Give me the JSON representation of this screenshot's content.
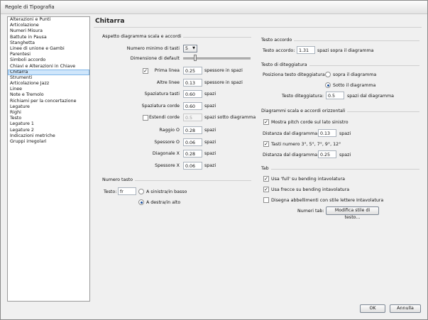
{
  "window": {
    "title": "Regole di Tipografia"
  },
  "sidebar": {
    "items": [
      "Alterazioni e Punti",
      "Articolazione",
      "Numeri Misura",
      "Battute in Pausa",
      "Stanghetta",
      "Linee di unione e Gambi",
      "Parentesi",
      "Simboli accordo",
      "Chiavi e Alterazioni in Chiave",
      "Chitarra",
      "Strumenti",
      "Articolazione Jazz",
      "Linee",
      "Note e Tremolo",
      "Richiami per la concertazione",
      "Legature",
      "Righi",
      "Testo",
      "Legature 1",
      "Legature 2",
      "Indicazioni metriche",
      "Gruppi irregolari"
    ],
    "selected": "Chitarra"
  },
  "page_title": "Chitarra",
  "scale": {
    "title": "Aspetto diagramma scala e accordi",
    "min_frets_label": "Numero minimo di tasti",
    "min_frets_value": "5",
    "default_size_label": "Dimensione di default",
    "first_line_label": "Prima linea",
    "first_line_value": "0.25",
    "first_line_checked": true,
    "first_line_unit": "spessore in spazi",
    "other_lines_label": "Altre linee",
    "other_lines_value": "0.13",
    "other_lines_unit": "spessore in spazi",
    "fret_spacing_label": "Spaziatura tasti",
    "fret_spacing_value": "0.60",
    "unit_spazi": "spazi",
    "string_spacing_label": "Spaziatura corde",
    "string_spacing_value": "0.60",
    "extend_strings_label": "Estendi corde",
    "extend_strings_value": "0.5",
    "extend_strings_unit": "spazi sotto diagramma",
    "radius_o_label": "Raggio O",
    "radius_o_value": "0.28",
    "thick_o_label": "Spessore O",
    "thick_o_value": "0.06",
    "diag_x_label": "Diagonale X",
    "diag_x_value": "0.28",
    "thick_x_label": "Spessore X",
    "thick_x_value": "0.06"
  },
  "tab_numbers": {
    "title": "Numero tasto",
    "text_label": "Testo:",
    "text_value": "fr",
    "left_below": "A sinistra/in basso",
    "right_above": "A destra/in alto"
  },
  "chord_text": {
    "title": "Testo accordo",
    "label": "Testo accordo:",
    "value": "1.31",
    "unit": "spazi sopra il diagramma"
  },
  "fingering": {
    "title": "Testo di diteggiatura",
    "position_label": "Posiziona testo diteggiatura:",
    "above": "sopra il diagramma",
    "below": "Sotto il diagramma",
    "text_label": "Testo diteggiatura:",
    "text_value": "0.5",
    "text_unit": "spazi dal diagramma"
  },
  "horizontal": {
    "title": "Diagrammi scala e accordi orizzontali",
    "show_pitch": "Mostra pitch corde sul lato sinistro",
    "dist1_label": "Distanza dal diagramma:",
    "dist1_value": "0.13",
    "unit": "spazi",
    "fret_numbers": "Tasti numero 3°, 5°, 7°, 9°, 12°",
    "dist2_label": "Distanza dal diagramma:",
    "dist2_value": "0.25"
  },
  "tab": {
    "title": "Tab",
    "full_bend": "Usa 'full' su bending intavolatura",
    "arrows": "Usa frecce su bending intavolatura",
    "draw_ornaments": "Disegna abbellimenti con stile lettere Intavolatura",
    "num_label": "Numeri tab:",
    "num_button": "Modifica stile di testo..."
  },
  "footer": {
    "ok": "OK",
    "cancel": "Annulla"
  }
}
